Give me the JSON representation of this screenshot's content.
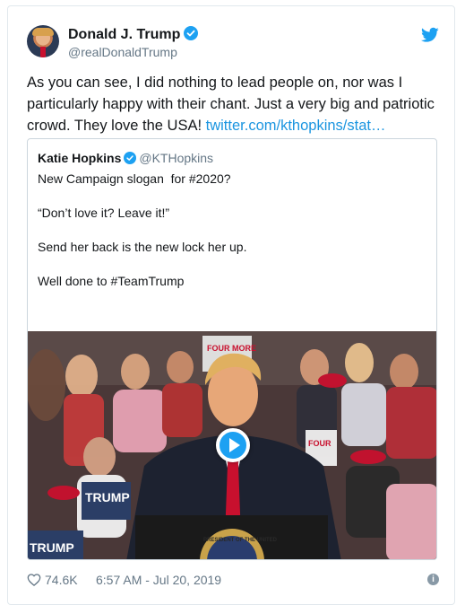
{
  "tweet": {
    "author": {
      "display_name": "Donald J. Trump",
      "handle": "@realDonaldTrump",
      "verified": true
    },
    "text": "As you can see, I did nothing to lead people on, nor was I particularly happy with their chant. Just a very big and patriotic crowd. They love the USA!",
    "link_text": "twitter.com/kthopkins/stat…",
    "likes": "74.6K",
    "timestamp": "6:57 AM - Jul 20, 2019",
    "icons": {
      "brand": "twitter-bird-icon",
      "like": "heart-icon",
      "info": "info-icon"
    }
  },
  "quoted_tweet": {
    "author": {
      "display_name": "Katie Hopkins",
      "handle": "@KTHopkins",
      "verified": true
    },
    "lines": [
      "New Campaign slogan  for #2020?",
      "“Don’t love it? Leave it!”",
      "Send her back is the new lock her up.",
      "Well done to #TeamTrump"
    ],
    "media": {
      "type": "video",
      "sign_text_1": "FOUR MORE",
      "sign_text_2": "TRUMP",
      "sign_text_3": "FOUR",
      "podium_text": "PRESIDENT OF THE UNITED"
    }
  },
  "colors": {
    "accent": "#1da1f2",
    "link": "#1b95e0",
    "secondary_text": "#657786",
    "tie": "#c8102e"
  }
}
